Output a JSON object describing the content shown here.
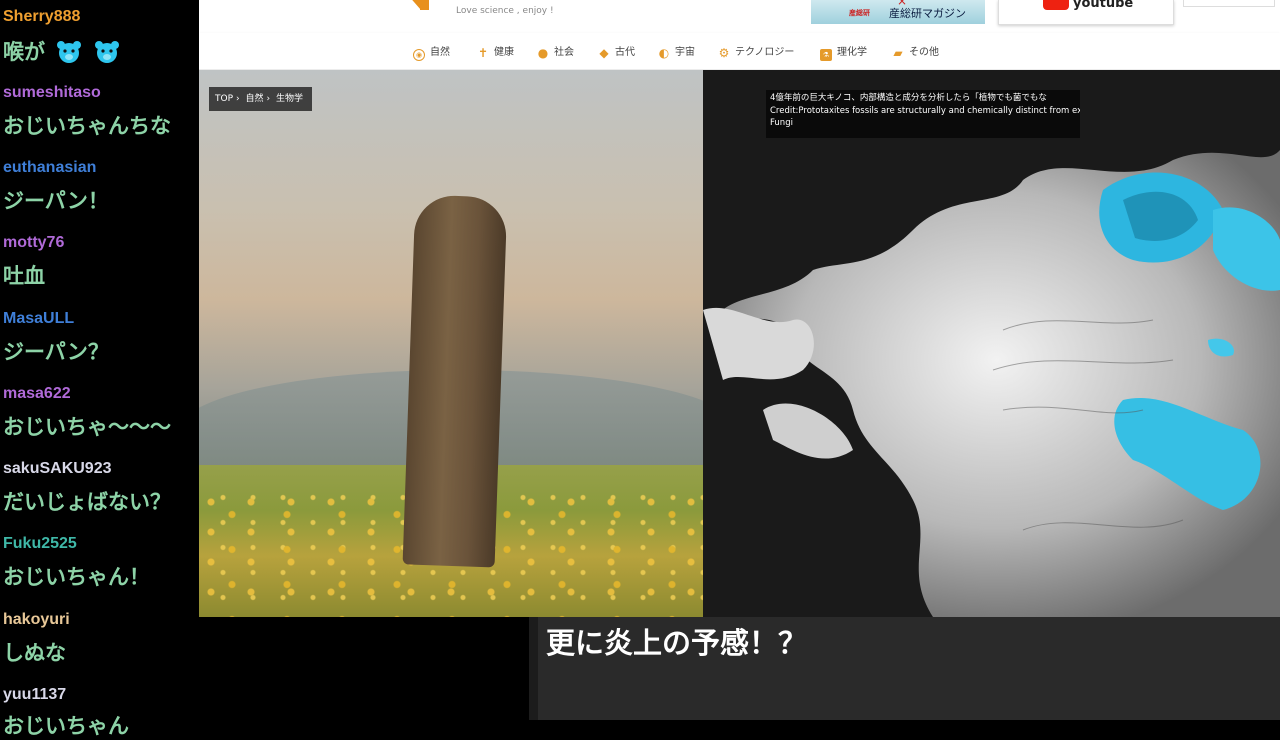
{
  "site": {
    "tagline": "Love science , enjoy !",
    "banners": {
      "aist_brand": "産総研",
      "aist_title": "産総研マガジン",
      "youtube_text": "youtube"
    },
    "nav": [
      {
        "label": "自然",
        "icon": "leaf-circle-icon"
      },
      {
        "label": "健康",
        "icon": "person-icon"
      },
      {
        "label": "社会",
        "icon": "globe-icon"
      },
      {
        "label": "古代",
        "icon": "arrowhead-icon"
      },
      {
        "label": "宇宙",
        "icon": "planet-icon"
      },
      {
        "label": "テクノロジー",
        "icon": "robot-icon"
      },
      {
        "label": "理化学",
        "icon": "flask-square-icon"
      },
      {
        "label": "その他",
        "icon": "book-icon"
      }
    ],
    "breadcrumb": [
      "TOP",
      "自然",
      "生物学"
    ],
    "caption_lines": [
      "4億年前の巨大キノコ、内部構造と成分を分析したら「植物でも菌でもな",
      "Credit:Prototaxites fossils are structurally and chemically distinct from ex",
      "Fungi"
    ]
  },
  "chat": [
    {
      "user": "Sherry888",
      "color": "#f0a030",
      "text": "喉が"
    },
    {
      "user": "sumeshitaso",
      "color": "#b06ad8",
      "text": "おじいちゃんちな"
    },
    {
      "user": "euthanasian",
      "color": "#3f7fd8",
      "text": "ジーパン！"
    },
    {
      "user": "motty76",
      "color": "#b06ad8",
      "text": "吐血"
    },
    {
      "user": "MasaULL",
      "color": "#3f7fd8",
      "text": "ジーパン？"
    },
    {
      "user": "masa622",
      "color": "#b06ad8",
      "text": "おじいちゃ～～～"
    },
    {
      "user": "sakuSAKU923",
      "color": "#d8d8e8",
      "text": "だいじょばない？"
    },
    {
      "user": "Fuku2525",
      "color": "#3fb8a8",
      "text": "おじいちゃん！"
    },
    {
      "user": "hakoyuri",
      "color": "#e8c898",
      "text": "しぬな"
    },
    {
      "user": "yuu1137",
      "color": "#d8d8e8",
      "text": "おじいちゃん"
    }
  ],
  "subtitle": "更に炎上の予感！？"
}
